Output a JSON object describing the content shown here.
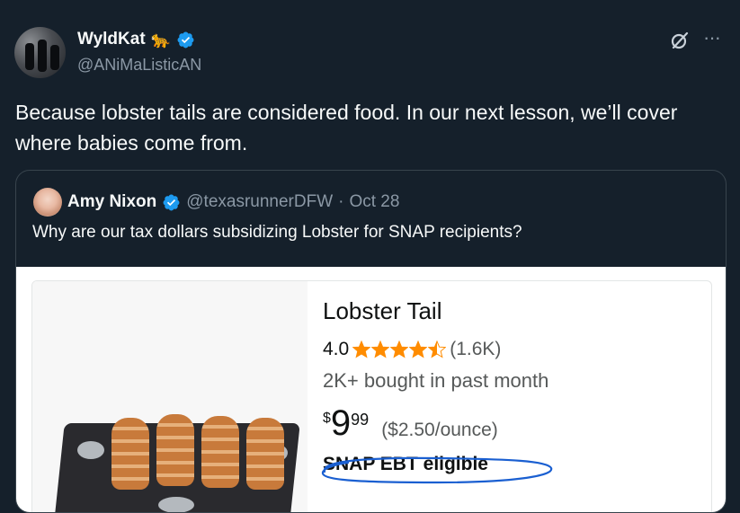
{
  "author": {
    "display_name": "WyldKat",
    "emoji": "🐆",
    "handle": "@ANiMaListicAN"
  },
  "tweet": {
    "text": "Because lobster tails are considered food. In our next lesson, we’ll cover where babies come from."
  },
  "icons": {
    "grok": "grok-icon",
    "more": "more-icon",
    "verified": "verified-badge-icon",
    "star": "star-icon"
  },
  "quoted": {
    "display_name": "Amy Nixon",
    "handle": "@texasrunnerDFW",
    "separator": "·",
    "date": "Oct 28",
    "text": "Why are our tax dollars subsidizing Lobster for SNAP recipients?",
    "product": {
      "title": "Lobster Tail",
      "rating": "4.0",
      "stars": 4.5,
      "rating_count": "(1.6K)",
      "bought": "2K+ bought in past month",
      "currency": "$",
      "price_whole": "9",
      "price_fraction": "99",
      "unit_price": "($2.50/ounce)",
      "snap": "SNAP EBT eligible"
    }
  },
  "colors": {
    "background": "#15202b",
    "text": "#f7f9f9",
    "muted": "#8b98a5",
    "verified": "#1d9bf0",
    "star": "#ff8c00",
    "annotation": "#1a5fd1"
  },
  "more_label": "···"
}
